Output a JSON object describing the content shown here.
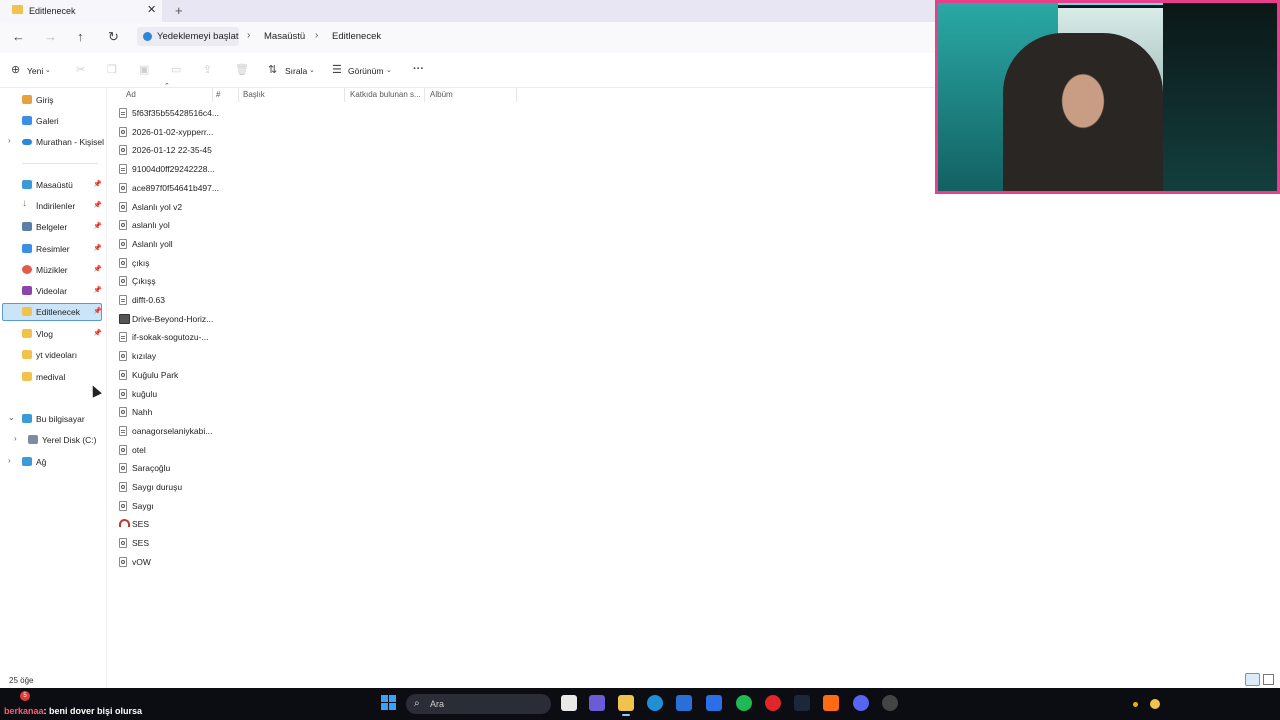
{
  "window": {
    "tab_title": "Editlenecek",
    "tab_close": "✕",
    "new_tab": "+"
  },
  "address_bar": {
    "backup_label": "Yedeklemeyi başlat",
    "breadcrumbs": [
      "Masaüstü",
      "Editlenecek"
    ],
    "separator": "›"
  },
  "command_bar": {
    "new_label": "Yeni",
    "sort_label": "Sırala",
    "view_label": "Görünüm",
    "more_label": "···"
  },
  "sidebar": {
    "top_items": [
      {
        "label": "Giriş"
      },
      {
        "label": "Galeri"
      },
      {
        "label": "Murathan - Kişisel"
      }
    ],
    "quick_access": [
      {
        "label": "Masaüstü",
        "pinned": true
      },
      {
        "label": "İndirilenler",
        "pinned": true
      },
      {
        "label": "Belgeler",
        "pinned": true
      },
      {
        "label": "Resimler",
        "pinned": true
      },
      {
        "label": "Müzikler",
        "pinned": true
      },
      {
        "label": "Videolar",
        "pinned": true
      },
      {
        "label": "Editlenecek",
        "pinned": true,
        "selected": true
      },
      {
        "label": "Vlog",
        "pinned": true
      },
      {
        "label": "yt videoları",
        "pinned": false
      },
      {
        "label": "medival",
        "pinned": false
      }
    ],
    "devices": [
      {
        "label": "Bu bilgisayar"
      },
      {
        "label": "Yerel Disk (C:)"
      },
      {
        "label": "Ağ"
      }
    ]
  },
  "columns": {
    "name": "Ad",
    "number": "#",
    "title": "Başlık",
    "contributing": "Katkıda bulunan s...",
    "album": "Albüm"
  },
  "files": [
    {
      "name": "5f63f35b55428516c4...",
      "icon": "text-file-icon"
    },
    {
      "name": "2026-01-02-xypperr...",
      "icon": "media-file-icon"
    },
    {
      "name": "2026-01-12 22-35-45",
      "icon": "media-file-icon"
    },
    {
      "name": "91004d0ff29242228...",
      "icon": "text-file-icon"
    },
    {
      "name": "ace897f0f54641b497...",
      "icon": "media-file-icon"
    },
    {
      "name": "Aslanlı yol v2",
      "icon": "media-file-icon"
    },
    {
      "name": "aslanlı yol",
      "icon": "media-file-icon"
    },
    {
      "name": "Aslanlı yoll",
      "icon": "media-file-icon"
    },
    {
      "name": "çıkış",
      "icon": "media-file-icon"
    },
    {
      "name": "Çıkışş",
      "icon": "media-file-icon"
    },
    {
      "name": "difft-0.63",
      "icon": "text-file-icon"
    },
    {
      "name": "Drive-Beyond-Horiz...",
      "icon": "zip-file-icon"
    },
    {
      "name": "if-sokak-sogutozu-...",
      "icon": "text-file-icon"
    },
    {
      "name": "kızılay",
      "icon": "media-file-icon"
    },
    {
      "name": "Kuğulu Park",
      "icon": "media-file-icon"
    },
    {
      "name": "kuğulu",
      "icon": "media-file-icon"
    },
    {
      "name": "Nahh",
      "icon": "media-file-icon"
    },
    {
      "name": "oanagorselaniykabi...",
      "icon": "text-file-icon"
    },
    {
      "name": "otel",
      "icon": "media-file-icon"
    },
    {
      "name": "Saraçoğlu",
      "icon": "media-file-icon"
    },
    {
      "name": "Saygı duruşu",
      "icon": "media-file-icon"
    },
    {
      "name": "Saygı",
      "icon": "media-file-icon"
    },
    {
      "name": "SES",
      "icon": "headphones-file-icon"
    },
    {
      "name": "SES",
      "icon": "media-file-icon"
    },
    {
      "name": "vOW",
      "icon": "media-file-icon"
    }
  ],
  "status": {
    "item_count": "25 öğe"
  },
  "chat": {
    "badge": "5",
    "user": "berkanaa",
    "message": ": beni dover bişi olursa"
  },
  "taskbar": {
    "search_placeholder": "Ara"
  },
  "colors": {
    "accent": "#5b9bd5",
    "selected_bg": "#cce4f7",
    "folder": "#f0c44c",
    "webcam_border": "#e83e8c"
  }
}
